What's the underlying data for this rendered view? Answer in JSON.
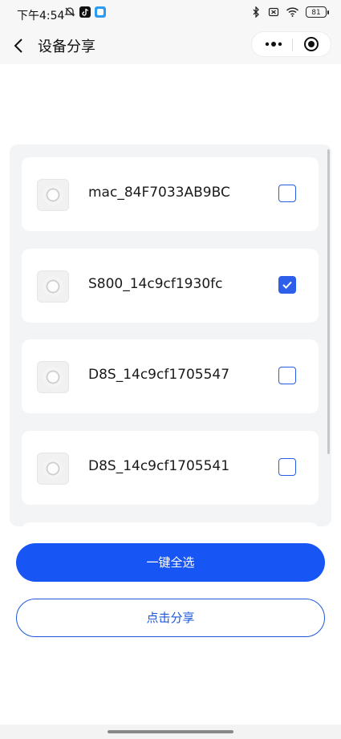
{
  "status_bar": {
    "time": "下午4:54",
    "battery": "81",
    "left_icons": [
      "mute-alarm-icon",
      "tiktok-icon",
      "app-icon"
    ],
    "right_icons": [
      "bluetooth-icon",
      "no-sim-icon",
      "wifi-icon",
      "battery-icon"
    ]
  },
  "nav": {
    "title": "设备分享",
    "back_icon": "chevron-left-icon",
    "more_icon": "more-dots-icon",
    "close_icon": "target-close-icon"
  },
  "devices": [
    {
      "name": "mac_84F7033AB9BC",
      "checked": false
    },
    {
      "name": "S800_14c9cf1930fc",
      "checked": true
    },
    {
      "name": "D8S_14c9cf1705547",
      "checked": false
    },
    {
      "name": "D8S_14c9cf1705541",
      "checked": false
    }
  ],
  "buttons": {
    "select_all": "一键全选",
    "share": "点击分享"
  },
  "colors": {
    "accent": "#1756f5",
    "panel_bg": "#f3f4f6",
    "outline": "#1d57d9"
  }
}
